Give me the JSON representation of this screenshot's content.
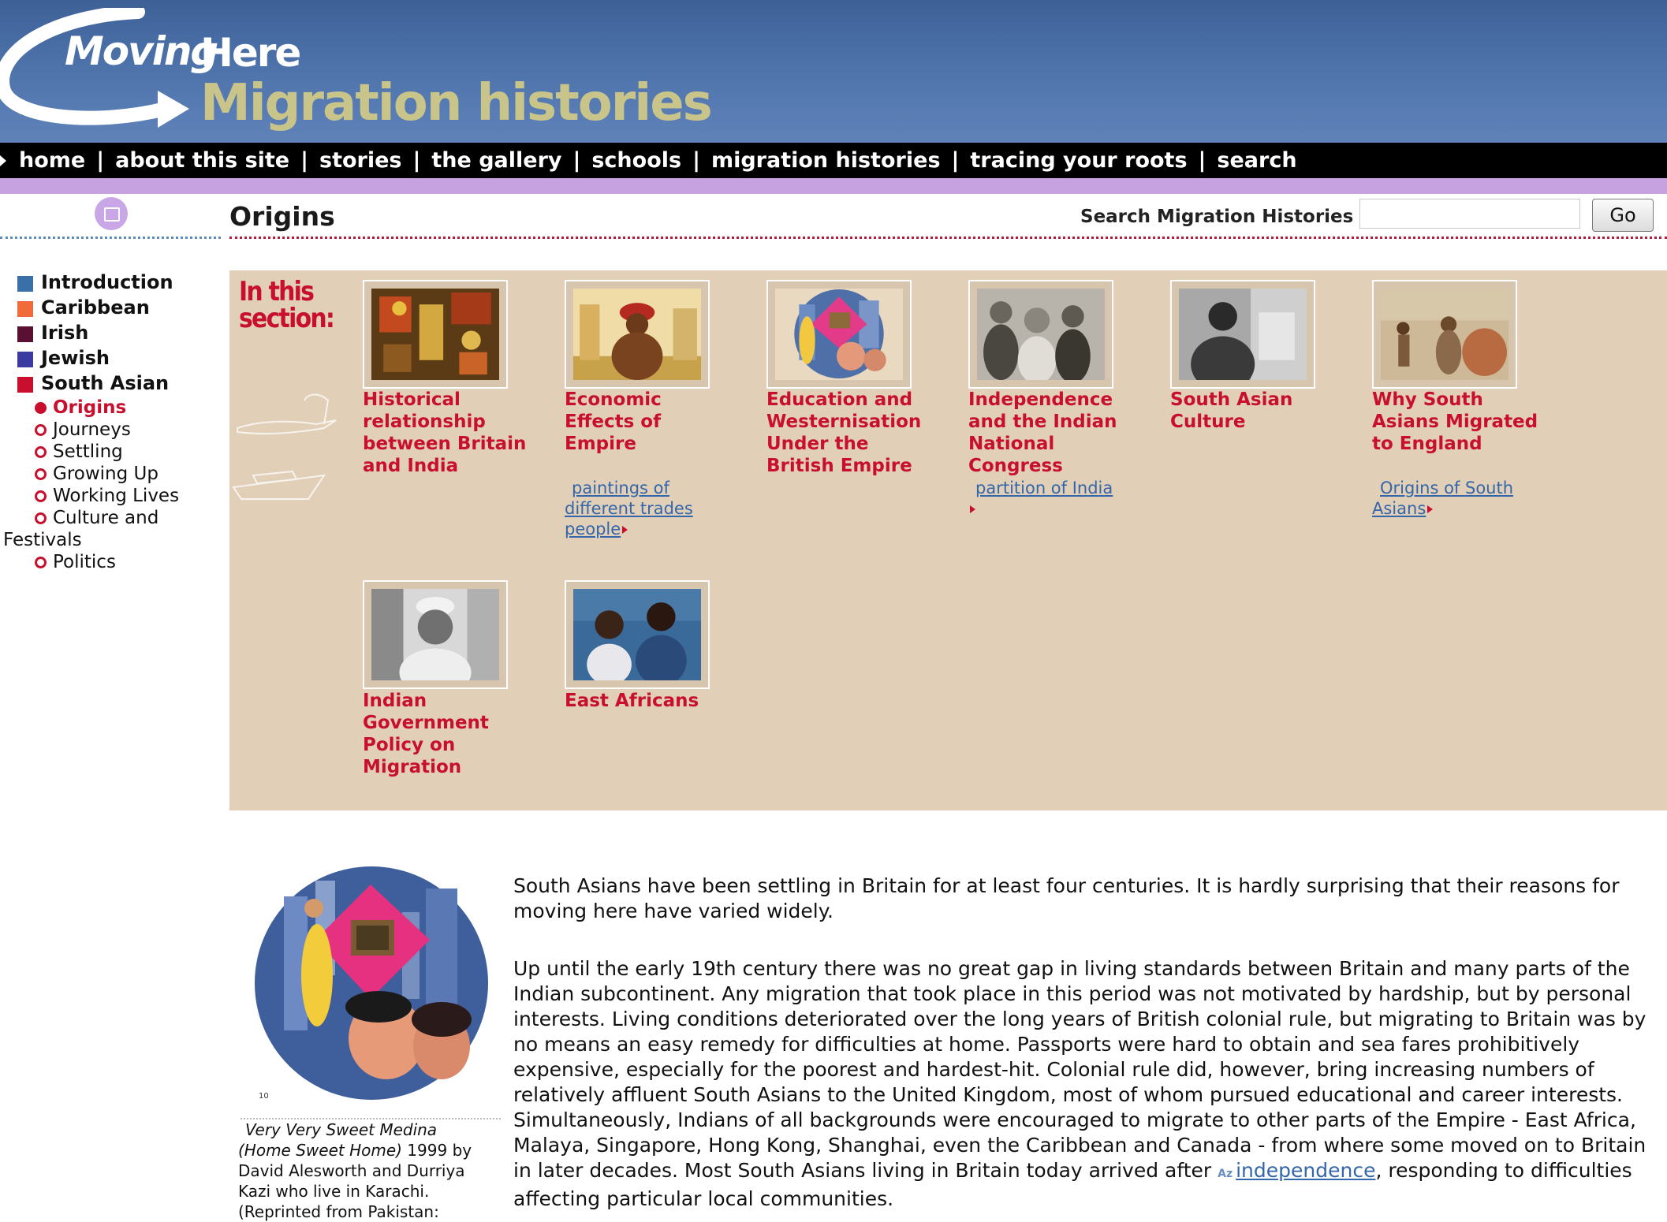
{
  "site": {
    "logo_moving": "Moving",
    "logo_here": "Here",
    "logo_subtitle": "Migration histories"
  },
  "nav": {
    "items": [
      "home",
      "about this site",
      "stories",
      "the gallery",
      "schools",
      "migration histories",
      "tracing your roots",
      "search"
    ],
    "separator": "|"
  },
  "section": {
    "title": "Origins",
    "search_label": "Search Migration Histories",
    "search_value": "",
    "go_label": "Go"
  },
  "sidebar": {
    "main_items": [
      {
        "label": "Introduction",
        "color": "#3a6fa8"
      },
      {
        "label": "Caribbean",
        "color": "#f06a3a"
      },
      {
        "label": "Irish",
        "color": "#5a1030"
      },
      {
        "label": "Jewish",
        "color": "#3a3aa0"
      },
      {
        "label": "South Asian",
        "color": "#c8102e"
      }
    ],
    "sub_items": [
      "Origins",
      "Journeys",
      "Settling",
      "Growing Up",
      "Working Lives",
      "Culture and",
      "Festivals",
      "Politics"
    ]
  },
  "panel": {
    "heading_line1": "In this",
    "heading_line2": "section:",
    "background": "#e1cfb8",
    "cards": [
      {
        "title": [
          "Historical",
          "relationship",
          "between Britain",
          "and India"
        ],
        "links": []
      },
      {
        "title": [
          "Economic",
          "Effects of",
          "Empire"
        ],
        "links": [
          "paintings of",
          "different trades",
          "people"
        ]
      },
      {
        "title": [
          "Education and",
          "Westernisation",
          "Under the",
          "British Empire"
        ],
        "links": []
      },
      {
        "title": [
          "Independence",
          "and the Indian",
          "National",
          "Congress"
        ],
        "links": [
          "partition of India"
        ]
      },
      {
        "title": [
          "South Asian",
          "Culture"
        ],
        "links": []
      },
      {
        "title": [
          "Why South",
          "Asians Migrated",
          "to England"
        ],
        "links": [
          "Origins of South",
          "Asians"
        ]
      },
      {
        "title": [
          "Indian",
          "Government",
          "Policy on",
          "Migration"
        ],
        "links": []
      },
      {
        "title": [
          "East Africans"
        ],
        "links": []
      }
    ]
  },
  "caption": {
    "title_line1": "Very Very Sweet Medina",
    "title_line2": "(Home Sweet Home)",
    "year_by": " 1999 by",
    "line3": "David Alesworth and Durriya",
    "line4": "Kazi who live in Karachi.",
    "line5": "(Reprinted from Pakistan:",
    "image_number": "10"
  },
  "body": {
    "para1": "South Asians have been settling in Britain for at least four centuries. It is hardly surprising that their reasons for moving here have varied widely.",
    "para2_before": "Up until the early 19th century there was no great gap in living standards between Britain and many parts of the Indian subcontinent. Any migration that took place in this period was not motivated by hardship, but by personal interests. Living conditions deteriorated over the long years of British colonial rule, but migrating to Britain was by no means an easy remedy for difficulties at home. Passports were hard to obtain and sea fares prohibitively expensive, especially for the poorest and hardest-hit. Colonial rule did, however, bring increasing numbers of relatively affluent South Asians to the United Kingdom, most of whom pursued educational and career interests. Simultaneously, Indians of all backgrounds were encouraged to migrate to other parts of the Empire - East Africa, Malaya, Singapore, Hong Kong, Shanghai, even the Caribbean and Canada - from where some moved on to Britain in later decades. Most South Asians living in Britain today arrived after ",
    "az_glyph": "Az",
    "link_text": "independence",
    "para2_after": ", responding to difficulties affecting particular local communities."
  }
}
